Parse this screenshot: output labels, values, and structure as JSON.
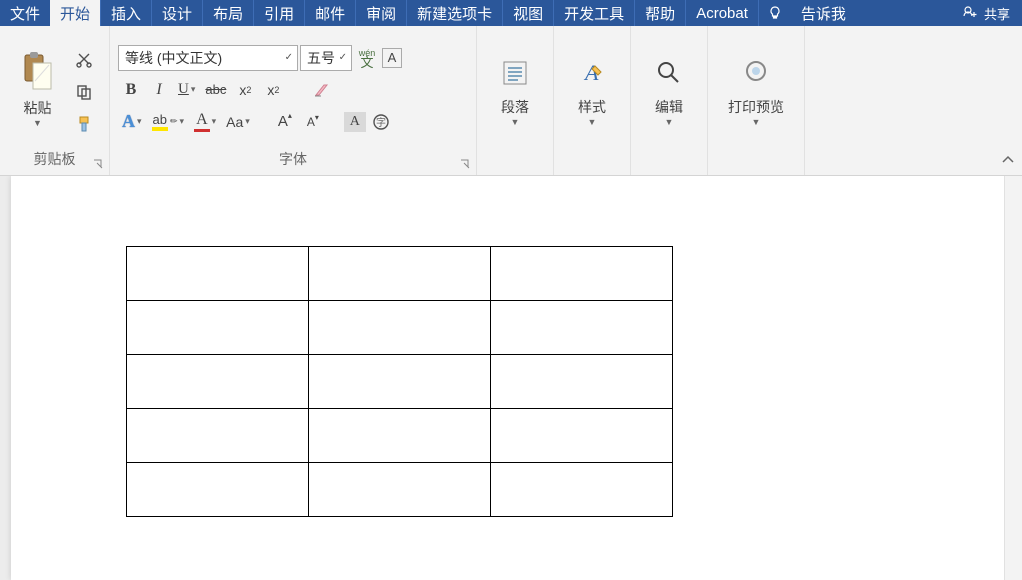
{
  "tabs": {
    "file": "文件",
    "home": "开始",
    "insert": "插入",
    "design": "设计",
    "layout": "布局",
    "references": "引用",
    "mailings": "邮件",
    "review": "审阅",
    "newtab": "新建选项卡",
    "view": "视图",
    "dev": "开发工具",
    "help": "帮助",
    "acrobat": "Acrobat",
    "tellme": "告诉我",
    "share": "共享"
  },
  "clipboard": {
    "paste": "粘贴",
    "group": "剪贴板"
  },
  "font": {
    "group": "字体",
    "name": "等线 (中文正文)",
    "size": "五号",
    "pinyin_top": "wén",
    "pinyin_bottom": "文"
  },
  "groups": {
    "paragraph": "段落",
    "styles": "样式",
    "editing": "编辑",
    "printpreview": "打印预览"
  },
  "doc_table": {
    "rows": 5,
    "cols": 3
  }
}
